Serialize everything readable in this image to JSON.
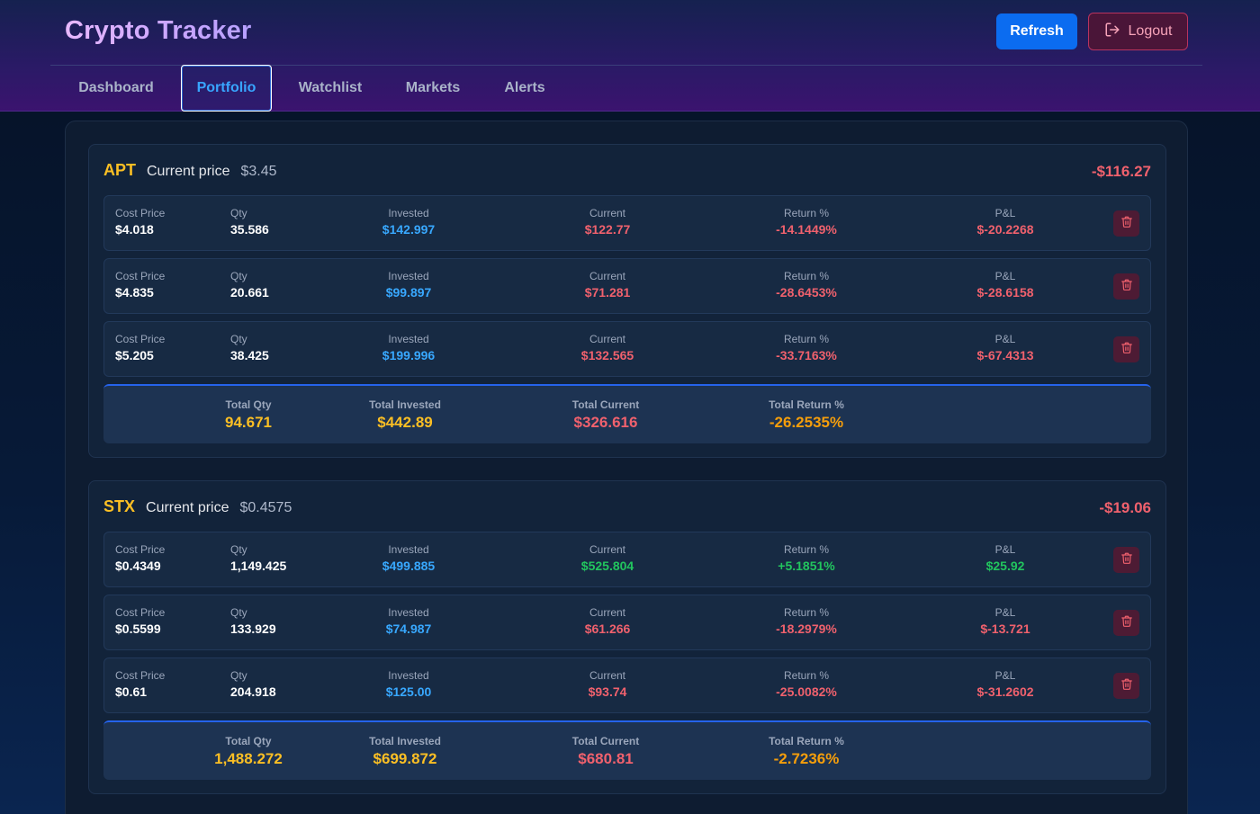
{
  "header": {
    "title": "Crypto Tracker",
    "refresh_label": "Refresh",
    "logout_label": "Logout"
  },
  "nav": {
    "tabs": [
      {
        "label": "Dashboard",
        "active": false
      },
      {
        "label": "Portfolio",
        "active": true
      },
      {
        "label": "Watchlist",
        "active": false
      },
      {
        "label": "Markets",
        "active": false
      },
      {
        "label": "Alerts",
        "active": false
      }
    ]
  },
  "labels": {
    "current_price": "Current price",
    "cost_price": "Cost Price",
    "qty": "Qty",
    "invested": "Invested",
    "current": "Current",
    "return_pct": "Return %",
    "pnl": "P&L",
    "total_qty": "Total Qty",
    "total_invested": "Total Invested",
    "total_current": "Total Current",
    "total_return": "Total Return %"
  },
  "assets": [
    {
      "symbol": "APT",
      "current_price": "$3.45",
      "pnl": "-$116.27",
      "lots": [
        {
          "cost_price": "$4.018",
          "qty": "35.586",
          "invested": "$142.997",
          "current": "$122.77",
          "return_pct": "-14.1449%",
          "pnl": "$-20.2268",
          "positive": false
        },
        {
          "cost_price": "$4.835",
          "qty": "20.661",
          "invested": "$99.897",
          "current": "$71.281",
          "return_pct": "-28.6453%",
          "pnl": "$-28.6158",
          "positive": false
        },
        {
          "cost_price": "$5.205",
          "qty": "38.425",
          "invested": "$199.996",
          "current": "$132.565",
          "return_pct": "-33.7163%",
          "pnl": "$-67.4313",
          "positive": false
        }
      ],
      "totals": {
        "qty": "94.671",
        "invested": "$442.89",
        "current": "$326.616",
        "return_pct": "-26.2535%"
      }
    },
    {
      "symbol": "STX",
      "current_price": "$0.4575",
      "pnl": "-$19.06",
      "lots": [
        {
          "cost_price": "$0.4349",
          "qty": "1,149.425",
          "invested": "$499.885",
          "current": "$525.804",
          "return_pct": "+5.1851%",
          "pnl": "$25.92",
          "positive": true
        },
        {
          "cost_price": "$0.5599",
          "qty": "133.929",
          "invested": "$74.987",
          "current": "$61.266",
          "return_pct": "-18.2979%",
          "pnl": "$-13.721",
          "positive": false
        },
        {
          "cost_price": "$0.61",
          "qty": "204.918",
          "invested": "$125.00",
          "current": "$93.74",
          "return_pct": "-25.0082%",
          "pnl": "$-31.2602",
          "positive": false
        }
      ],
      "totals": {
        "qty": "1,488.272",
        "invested": "$699.872",
        "current": "$680.81",
        "return_pct": "-2.7236%"
      }
    }
  ],
  "colors": {
    "accent": "#0b6cf0",
    "positive": "#22c55e",
    "negative": "#f0616d",
    "invested": "#38a8ff",
    "highlight": "#fbbf24"
  }
}
